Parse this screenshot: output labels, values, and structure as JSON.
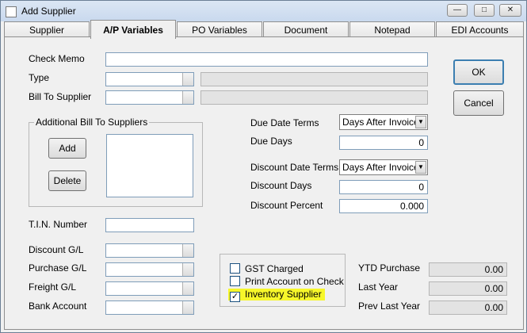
{
  "window": {
    "title": "Add Supplier"
  },
  "tabs": [
    "Supplier",
    "A/P Variables",
    "PO Variables",
    "Document",
    "Notepad",
    "EDI Accounts"
  ],
  "form": {
    "check_memo_label": "Check Memo",
    "check_memo_value": "",
    "type_label": "Type",
    "bill_to_supplier_label": "Bill To Supplier",
    "additional_group_label": "Additional Bill To Suppliers",
    "add_button": "Add",
    "delete_button": "Delete",
    "tin_label": "T.I.N. Number",
    "discount_gl_label": "Discount G/L",
    "purchase_gl_label": "Purchase G/L",
    "freight_gl_label": "Freight G/L",
    "bank_account_label": "Bank Account",
    "due_date_terms_label": "Due Date Terms",
    "due_date_terms_value": "Days After Invoice",
    "due_days_label": "Due Days",
    "due_days_value": "0",
    "discount_date_terms_label": "Discount Date Terms",
    "discount_date_terms_value": "Days After Invoice",
    "discount_days_label": "Discount Days",
    "discount_days_value": "0",
    "discount_percent_label": "Discount Percent",
    "discount_percent_value": "0.000"
  },
  "checkboxes": [
    {
      "label": "GST Charged",
      "checked": false
    },
    {
      "label": "Print Account on Check",
      "checked": false
    },
    {
      "label": "Inventory Supplier",
      "checked": true
    }
  ],
  "totals": [
    {
      "label": "YTD Purchase",
      "value": "0.00"
    },
    {
      "label": "Last Year",
      "value": "0.00"
    },
    {
      "label": "Prev Last Year",
      "value": "0.00"
    }
  ],
  "buttons": {
    "ok": "OK",
    "cancel": "Cancel"
  },
  "highlight_color": "#f7f72a"
}
